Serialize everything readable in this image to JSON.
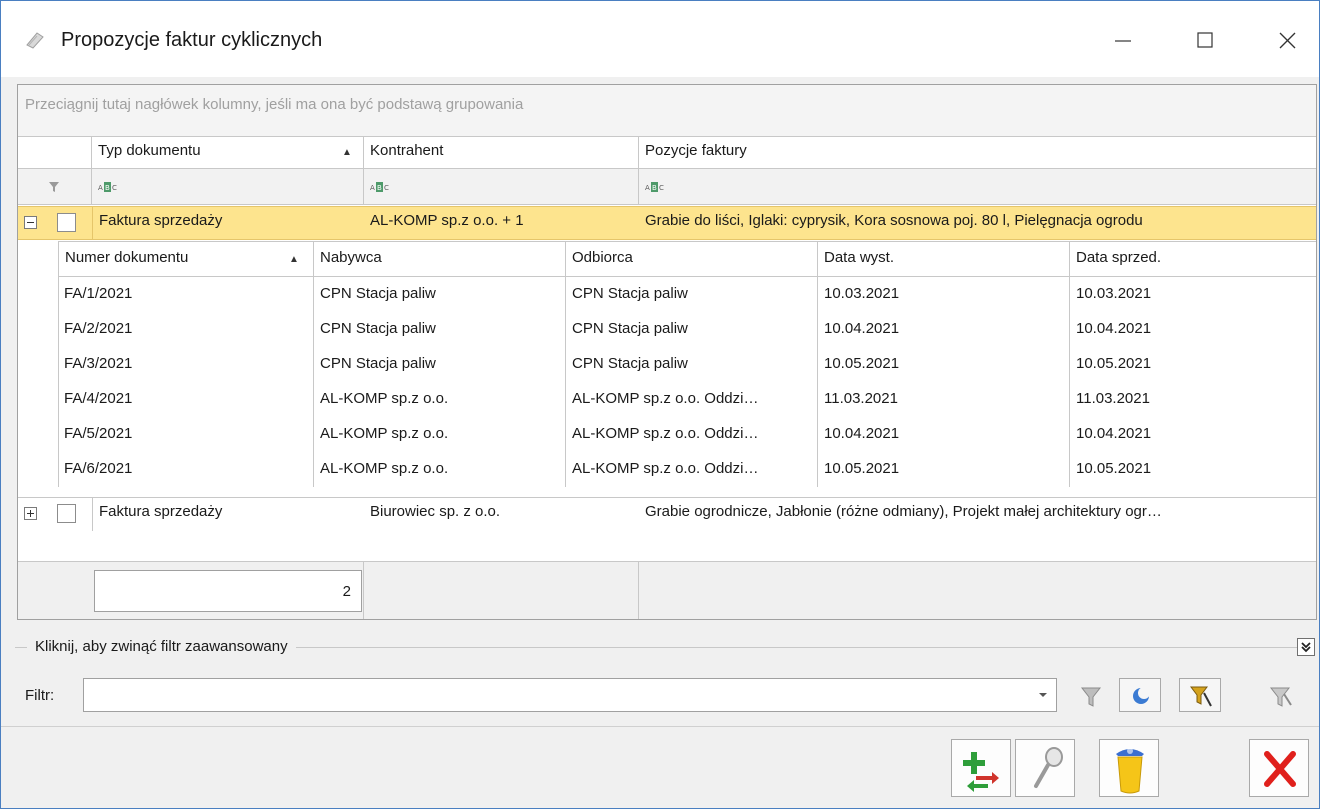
{
  "window": {
    "title": "Propozycje faktur cyklicznych",
    "minimize_icon": "minimize-icon",
    "maximize_icon": "maximize-icon",
    "close_icon": "close-icon"
  },
  "grid": {
    "group_panel_hint": "Przeciągnij tutaj nagłówek kolumny, jeśli ma ona być podstawą grupowania",
    "columns": [
      {
        "label": "Typ dokumentu",
        "sorted": "asc"
      },
      {
        "label": "Kontrahent"
      },
      {
        "label": "Pozycje faktury"
      }
    ],
    "filter_row_icon": "abc-filter-icon",
    "rows": [
      {
        "expanded": true,
        "selected": true,
        "type": "Faktura sprzedaży",
        "contractor": "AL-KOMP sp.z o.o. + 1",
        "items": "Grabie do liści, Iglaki: cyprysik, Kora sosnowa poj. 80 l, Pielęgnacja ogrodu"
      },
      {
        "expanded": false,
        "selected": false,
        "type": "Faktura sprzedaży",
        "contractor": "Biurowiec sp. z o.o.",
        "items": "Grabie ogrodnicze, Jabłonie (różne odmiany), Projekt małej architektury ogr…"
      }
    ],
    "detail": {
      "columns": [
        "Numer dokumentu",
        "Nabywca",
        "Odbiorca",
        "Data wyst.",
        "Data sprzed."
      ],
      "rows": [
        [
          "FA/1/2021",
          "CPN Stacja paliw",
          "CPN Stacja paliw",
          "10.03.2021",
          "10.03.2021"
        ],
        [
          "FA/2/2021",
          "CPN Stacja paliw",
          "CPN Stacja paliw",
          "10.04.2021",
          "10.04.2021"
        ],
        [
          "FA/3/2021",
          "CPN Stacja paliw",
          "CPN Stacja paliw",
          "10.05.2021",
          "10.05.2021"
        ],
        [
          "FA/4/2021",
          "AL-KOMP sp.z o.o.",
          "AL-KOMP sp.z o.o. Oddzi…",
          "11.03.2021",
          "11.03.2021"
        ],
        [
          "FA/5/2021",
          "AL-KOMP sp.z o.o.",
          "AL-KOMP sp.z o.o. Oddzi…",
          "10.04.2021",
          "10.04.2021"
        ],
        [
          "FA/6/2021",
          "AL-KOMP sp.z o.o.",
          "AL-KOMP sp.z o.o. Oddzi…",
          "10.05.2021",
          "10.05.2021"
        ]
      ]
    },
    "footer_count": "2"
  },
  "advanced_filter": {
    "collapse_label": "Kliknij, aby zwinąć filtr zaawansowany",
    "filter_label": "Filtr:",
    "filter_value": ""
  },
  "colors": {
    "selection": "#fde48e",
    "window_border": "#4a7fc1"
  }
}
